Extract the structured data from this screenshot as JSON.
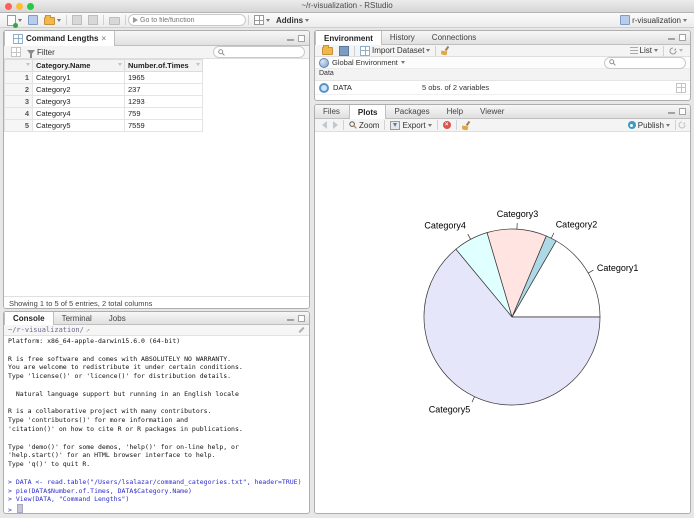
{
  "window": {
    "title": "~/r-visualization - RStudio",
    "project_label": "r-visualization"
  },
  "colors": {
    "traffic_close": "#ff5f57",
    "traffic_minimize": "#febc2e",
    "traffic_zoom": "#28c840",
    "console_input": "#2b2bcc"
  },
  "main_toolbar": {
    "goto_placeholder": "Go to file/function",
    "addins_label": "Addins"
  },
  "data_viewer": {
    "tab_label": "Command Lengths",
    "filter_label": "Filter",
    "footer": "Showing 1 to 5 of 5 entries, 2 total columns",
    "table": {
      "columns": [
        "",
        "Category.Name",
        "Number.of.Times"
      ],
      "rows": [
        [
          "1",
          "Category1",
          "1965"
        ],
        [
          "2",
          "Category2",
          "237"
        ],
        [
          "3",
          "Category3",
          "1293"
        ],
        [
          "4",
          "Category4",
          "759"
        ],
        [
          "5",
          "Category5",
          "7559"
        ]
      ]
    }
  },
  "console": {
    "tabs": [
      "Console",
      "Terminal",
      "Jobs"
    ],
    "active_tab": "Console",
    "path": "~/r-visualization/",
    "lines": [
      {
        "type": "output",
        "text": "Platform: x86_64-apple-darwin15.6.0 (64-bit)"
      },
      {
        "type": "output",
        "text": ""
      },
      {
        "type": "output",
        "text": "R is free software and comes with ABSOLUTELY NO WARRANTY."
      },
      {
        "type": "output",
        "text": "You are welcome to redistribute it under certain conditions."
      },
      {
        "type": "output",
        "text": "Type 'license()' or 'licence()' for distribution details."
      },
      {
        "type": "output",
        "text": ""
      },
      {
        "type": "output",
        "text": "  Natural language support but running in an English locale"
      },
      {
        "type": "output",
        "text": ""
      },
      {
        "type": "output",
        "text": "R is a collaborative project with many contributors."
      },
      {
        "type": "output",
        "text": "Type 'contributors()' for more information and"
      },
      {
        "type": "output",
        "text": "'citation()' on how to cite R or R packages in publications."
      },
      {
        "type": "output",
        "text": ""
      },
      {
        "type": "output",
        "text": "Type 'demo()' for some demos, 'help()' for on-line help, or"
      },
      {
        "type": "output",
        "text": "'help.start()' for an HTML browser interface to help."
      },
      {
        "type": "output",
        "text": "Type 'q()' to quit R."
      },
      {
        "type": "output",
        "text": ""
      },
      {
        "type": "input",
        "text": "> DATA <- read.table(\"/Users/lsalazar/command_categories.txt\", header=TRUE)"
      },
      {
        "type": "input",
        "text": "> pie(DATA$Number.of.Times, DATA$Category.Name)"
      },
      {
        "type": "input",
        "text": "> View(DATA, \"Command Lengths\")"
      },
      {
        "type": "input",
        "text": "> "
      }
    ]
  },
  "environment": {
    "tabs": [
      "Environment",
      "History",
      "Connections"
    ],
    "active_tab": "Environment",
    "import_label": "Import Dataset",
    "list_label": "List",
    "scope_label": "Global Environment",
    "section_label": "Data",
    "objects": [
      {
        "name": "DATA",
        "summary": "5 obs. of 2 variables"
      }
    ]
  },
  "plots": {
    "tabs": [
      "Files",
      "Plots",
      "Packages",
      "Help",
      "Viewer"
    ],
    "active_tab": "Plots",
    "zoom_label": "Zoom",
    "export_label": "Export",
    "publish_label": "Publish"
  },
  "chart_data": {
    "type": "pie",
    "title": "",
    "categories": [
      "Category1",
      "Category2",
      "Category3",
      "Category4",
      "Category5"
    ],
    "values": [
      1965,
      237,
      1293,
      759,
      7559
    ],
    "colors": [
      "#FFFFFF",
      "#ADD8E6",
      "#FFE4E1",
      "#E0FFFF",
      "#E6E6FA"
    ],
    "start_angle_deg": 0,
    "direction": "counterclockwise",
    "legend": "none"
  }
}
